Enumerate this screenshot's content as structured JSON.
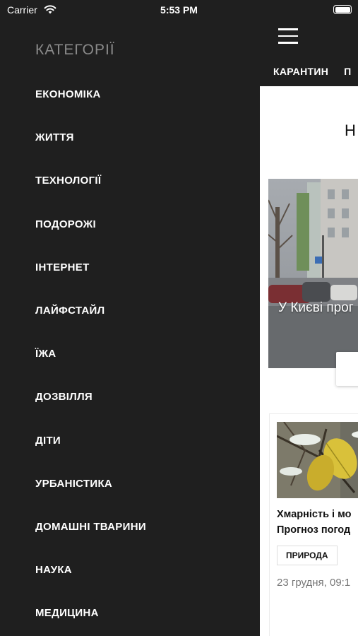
{
  "status_bar": {
    "carrier": "Carrier",
    "time": "5:53 PM"
  },
  "side_menu": {
    "title": "КАТЕГОРІЇ",
    "items": [
      {
        "label": "ЕКОНОМІКА"
      },
      {
        "label": "ЖИТТЯ"
      },
      {
        "label": "ТЕХНОЛОГІЇ"
      },
      {
        "label": "ПОДОРОЖІ"
      },
      {
        "label": "ІНТЕРНЕТ"
      },
      {
        "label": "ЛАЙФСТАЙЛ"
      },
      {
        "label": "ЇЖА"
      },
      {
        "label": "ДОЗВІЛЛЯ"
      },
      {
        "label": "ДІТИ"
      },
      {
        "label": "УРБАНІСТИКА"
      },
      {
        "label": "ДОМАШНІ ТВАРИНИ"
      },
      {
        "label": "НАУКА"
      },
      {
        "label": "МЕДИЦИНА"
      }
    ]
  },
  "main": {
    "tabs": [
      {
        "label": "КАРАНТИН"
      },
      {
        "label": "П"
      }
    ],
    "section_title": "Н",
    "featured": {
      "title": "У Києві прог"
    },
    "news_card": {
      "title_line1": "Хмарність і мо",
      "title_line2": "Прогноз погод",
      "tag": "ПРИРОДА",
      "date": "23 грудня, 09:1"
    }
  },
  "colors": {
    "background_dark": "#1f1f1f",
    "menu_title_gray": "#8a8a8a",
    "content_white": "#ffffff",
    "date_gray": "#777777"
  },
  "icons": {
    "menu": "hamburger-icon",
    "wifi": "wifi-icon",
    "battery": "battery-icon"
  }
}
